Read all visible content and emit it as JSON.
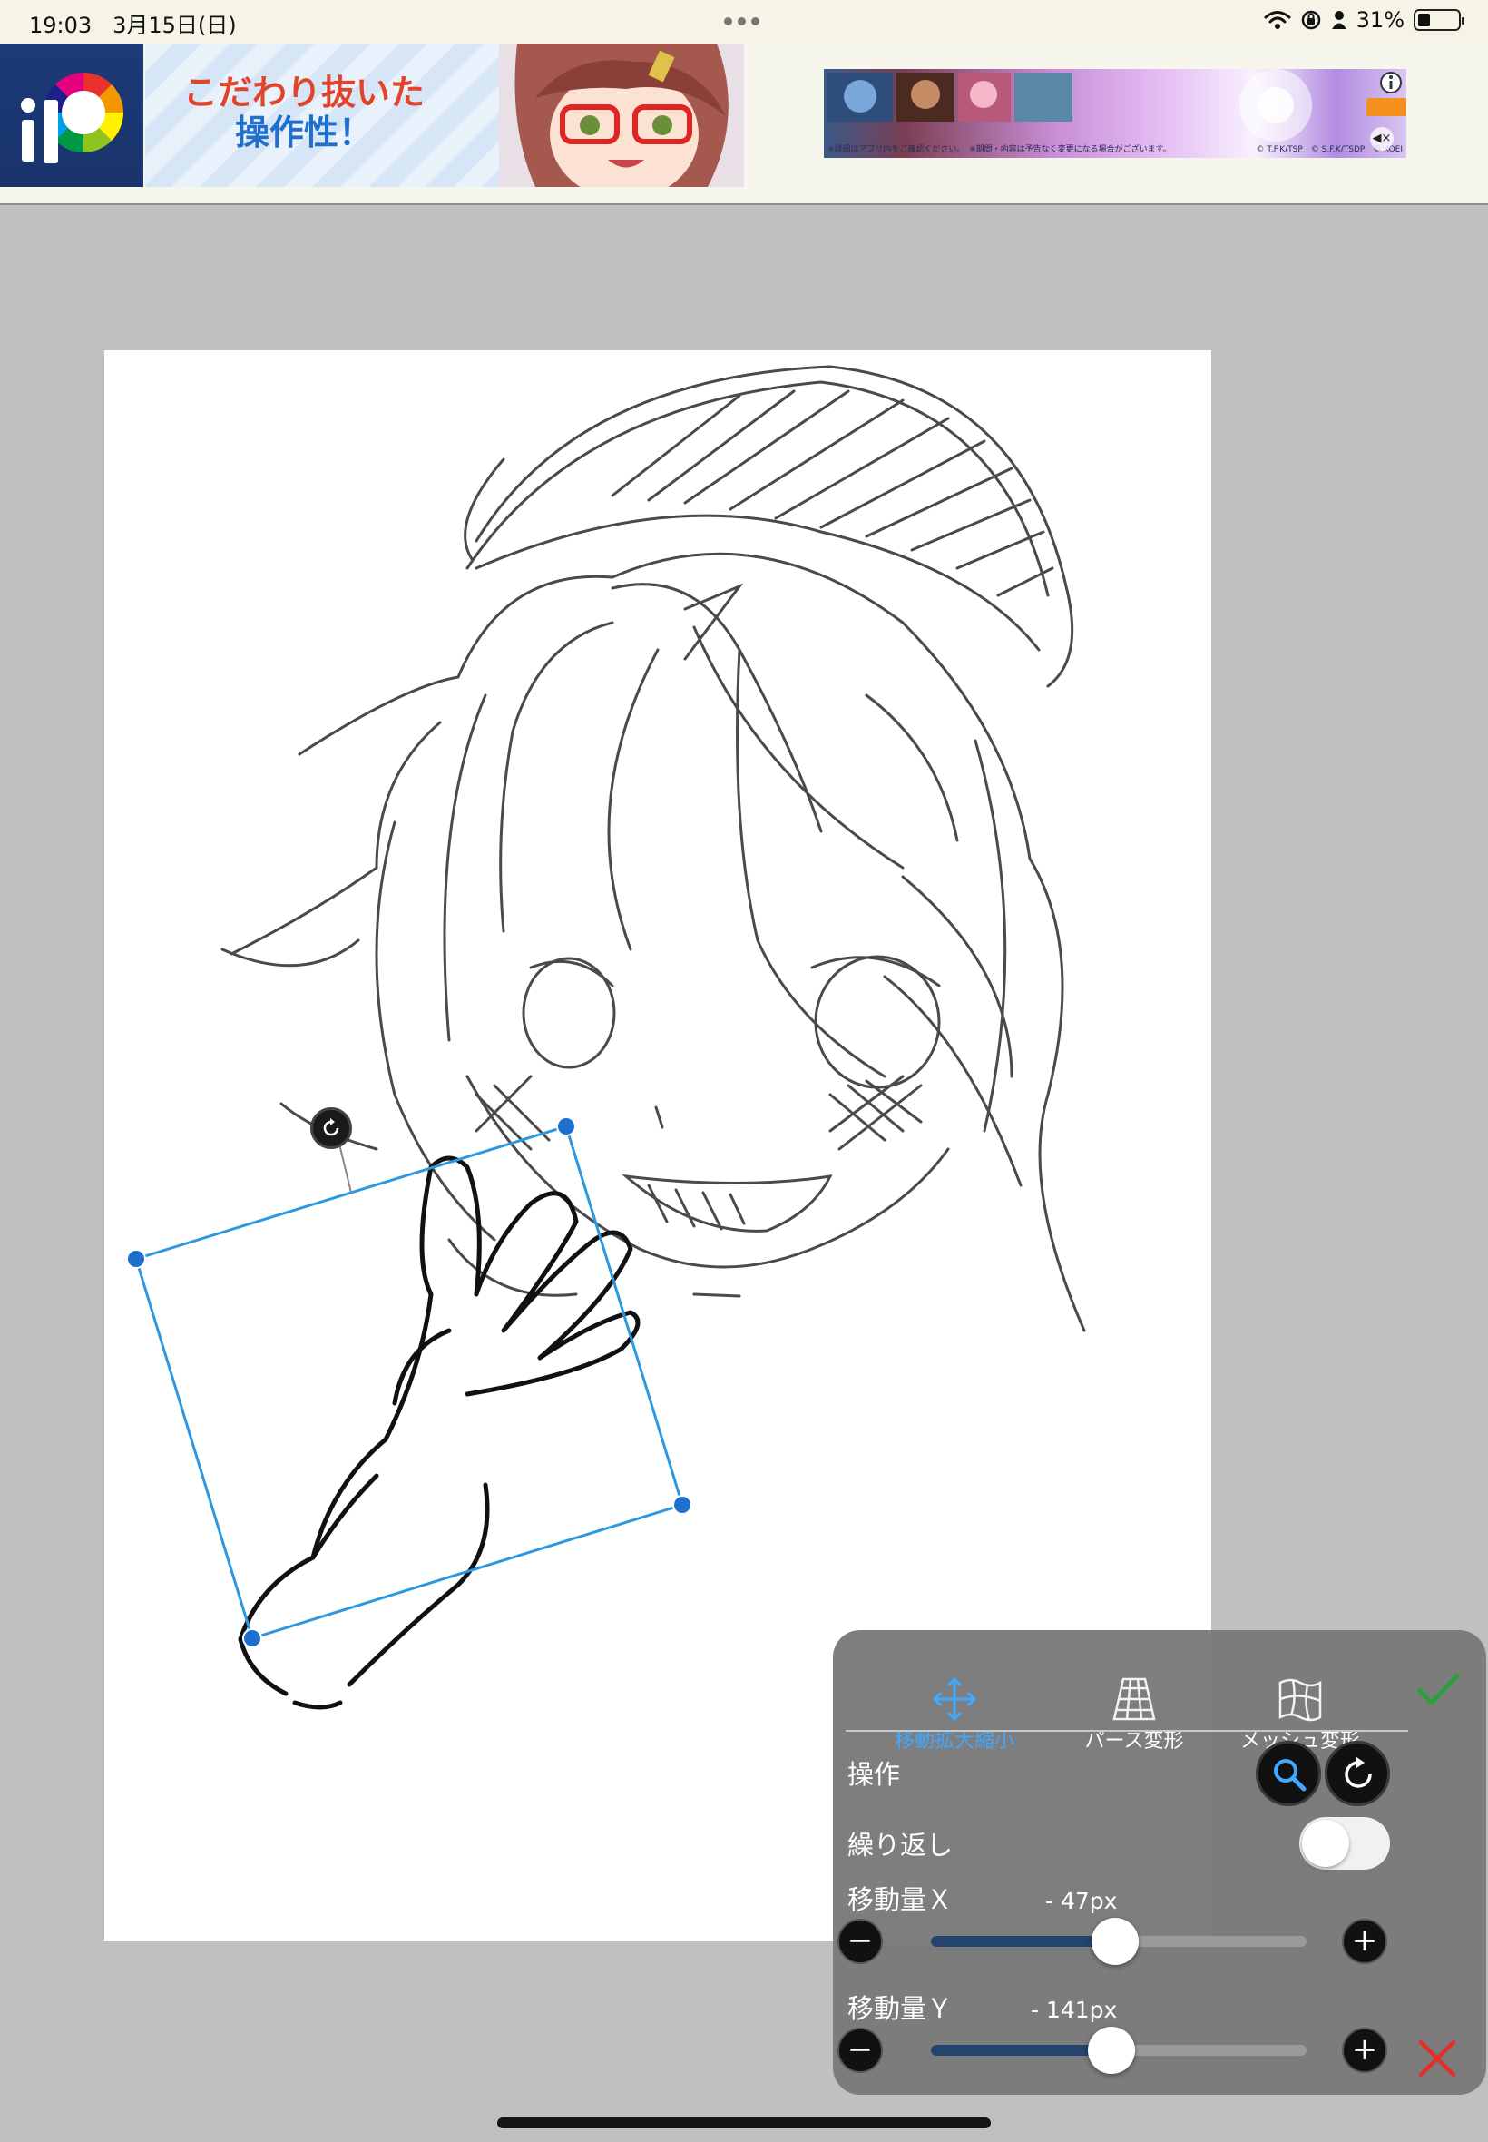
{
  "status_bar": {
    "time": "19:03",
    "date": "3月15日(日)",
    "battery_percent": "31%",
    "battery_level": 0.31,
    "icons": [
      "wifi-icon",
      "orientation-lock-icon",
      "person-icon",
      "battery-icon"
    ]
  },
  "ad_bar": {
    "banner_left": {
      "line1": "こだわり抜いた",
      "line2": "操作性！"
    },
    "banner_right": {
      "fineprint_left": "※詳細はアプリ内をご確認ください。　※期間・内容は予告なく変更になる場合がございます。",
      "fineprint_right": "© T.F.K/TSP　© S.F.K/TSDP　© KOEI"
    },
    "icons": [
      "app-logo-icon",
      "ad-info-icon",
      "mute-icon"
    ]
  },
  "transform_panel": {
    "tabs": [
      {
        "label": "移動拡大縮小",
        "icon": "move-arrows-icon",
        "active": true
      },
      {
        "label": "パース変形",
        "icon": "perspective-grid-icon",
        "active": false
      },
      {
        "label": "メッシュ変形",
        "icon": "mesh-icon",
        "active": false
      }
    ],
    "operation_label": "操作",
    "repeat_label": "繰り返し",
    "repeat_on": false,
    "move_x": {
      "label": "移動量Ｘ",
      "value_text": "- 47px",
      "value": -47,
      "position": 0.49
    },
    "move_y": {
      "label": "移動量Ｙ",
      "value_text": "- 141px",
      "value": -141,
      "position": 0.48
    },
    "confirm_icon": "checkmark-icon",
    "cancel_icon": "close-icon",
    "accent_color": "#41a8ff",
    "confirm_color": "#2c9f3c",
    "cancel_color": "#e0312a"
  },
  "selection_color": "#2e97e0"
}
